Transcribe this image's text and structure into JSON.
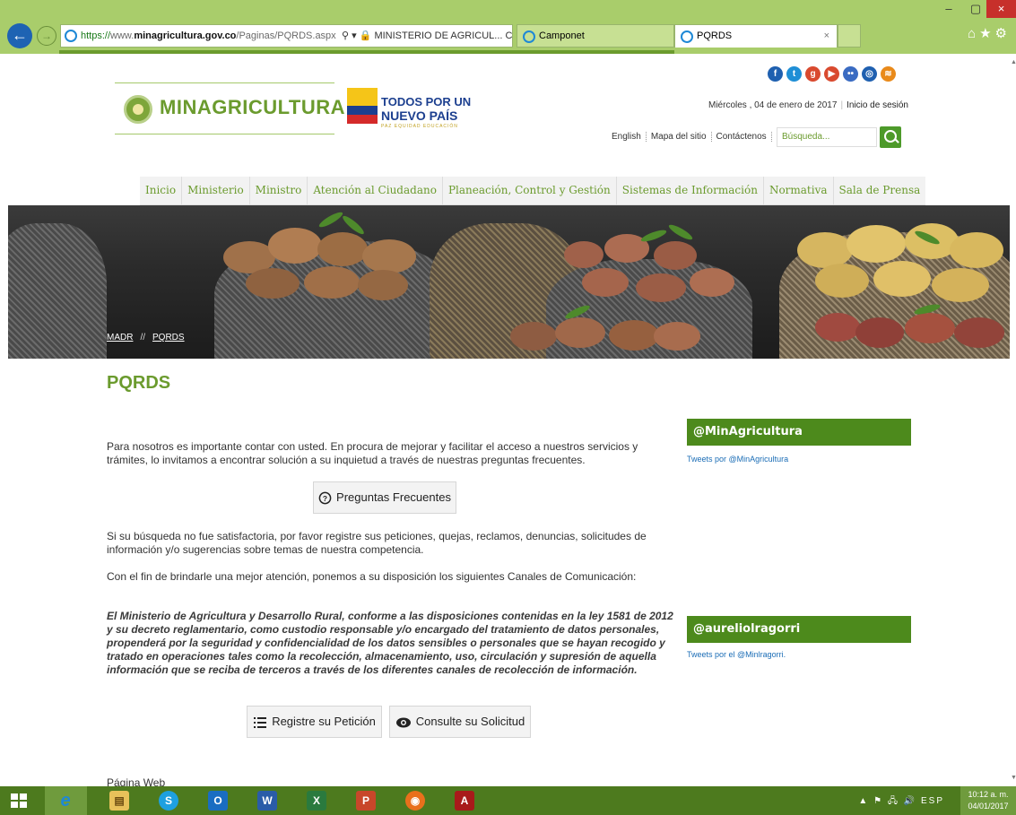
{
  "browser": {
    "url_scheme": "https://",
    "url_host_prefix": "www.",
    "url_host": "minagricultura.gov.co",
    "url_path": "/Paginas/PQRDS.aspx",
    "address_tools": "⚲ ▾ 🔒 MINISTERIO DE AGRICUL... C",
    "tabs": [
      {
        "label": "Camponet"
      },
      {
        "label": "PQRDS",
        "close": "×"
      }
    ],
    "window_controls": {
      "minimize": "–",
      "maximize": "▢",
      "close": "×"
    },
    "top_icons": "⌂★⚙"
  },
  "site": {
    "logo_text": "MINAGRICULTURA",
    "gov_logo": {
      "line1": "TODOS POR UN",
      "line2": "NUEVO PAÍS",
      "line3": "PAZ EQUIDAD EDUCACIÓN"
    },
    "social_icons": [
      "facebook-icon",
      "twitter-icon",
      "googleplus-icon",
      "youtube-icon",
      "flickr-icon",
      "instagram-icon",
      "rss-icon"
    ],
    "date": "Miércoles , 04 de enero de 2017",
    "login": "Inicio de sesión",
    "utility_links": [
      "English",
      "Mapa del sitio",
      "Contáctenos"
    ],
    "search_placeholder": "Búsqueda...",
    "menu": [
      "Inicio",
      "Ministerio",
      "Ministro",
      "Atención al Ciudadano",
      "Planeación, Control y Gestión",
      "Sistemas de Información",
      "Normativa",
      "Sala de Prensa"
    ],
    "breadcrumb": [
      "MADR",
      "PQRDS"
    ]
  },
  "content": {
    "title": "PQRDS",
    "intro": "Para nosotros es importante contar con usted. En procura de mejorar y facilitar el acceso a nuestros servicios y trámites, lo invitamos a encontrar solución a su inquietud a través de nuestras preguntas frecuentes.",
    "faq_button": "Preguntas Frecuentes",
    "paragraph2": "Si su búsqueda no fue satisfactoria, por favor registre sus peticiones, quejas, reclamos, denuncias, solicitudes de información y/o sugerencias sobre temas de nuestra competencia.",
    "paragraph3": "Con el fin de brindarle una mejor atención, ponemos a su disposición los siguientes Canales de Comunicación:",
    "legal": "El Ministerio de Agricultura y Desarrollo Rural, conforme a las disposiciones contenidas en la ley 1581 de 2012 y su decreto reglamentario, como custodio responsable y/o encargado del tratamiento de datos personales, propenderá por la seguridad y confidencialidad de los datos sensibles o personales que se hayan recogido y tratado en operaciones tales como la recolección, almacenamiento, uso, circulación y supresión de aquella información que se reciba de terceros a través de los diferentes canales de recolección de información.",
    "register_button": "Registre su Petición",
    "consult_button": "Consulte su Solicitud",
    "footer_cut": "Página Web"
  },
  "sidebar": {
    "twitter1_title": "@MinAgricultura",
    "twitter1_link": "Tweets por @MinAgricultura",
    "twitter2_title": "@aureliolragorri",
    "twitter2_link": "Tweets por el @Minlragorri."
  },
  "taskbar": {
    "apps": [
      "internet-explorer",
      "file-explorer",
      "skype",
      "outlook",
      "word",
      "excel",
      "powerpoint",
      "firefox",
      "acrobat"
    ],
    "tray_text": "▲ ⚑ 🖧 🔊 ESP",
    "clock_time": "10:12 a. m.",
    "clock_date": "04/01/2017"
  },
  "colors": {
    "brand_green": "#6b9b2e",
    "chrome_green": "#a9cd6b",
    "taskbar_green": "#4d7a1e"
  }
}
